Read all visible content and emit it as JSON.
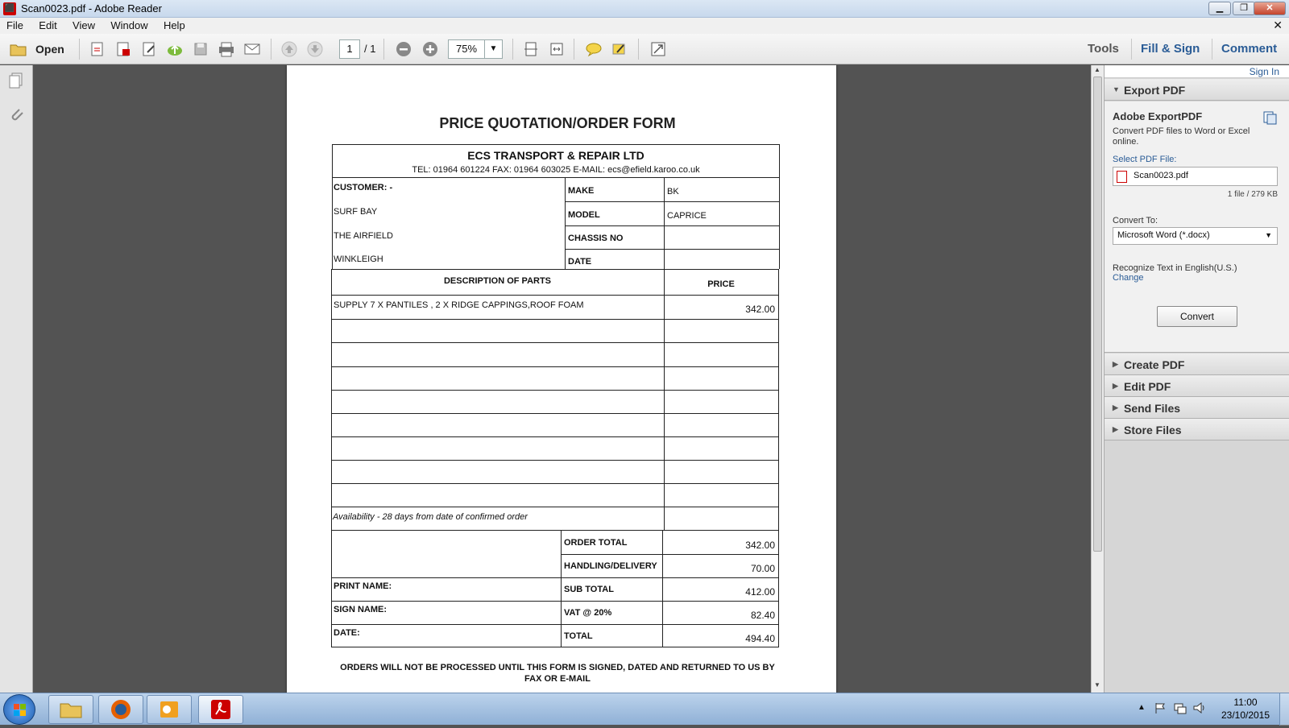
{
  "window": {
    "title": "Scan0023.pdf - Adobe Reader",
    "minimize": "▁",
    "maximize": "❐",
    "close": "✕",
    "doc_close": "✕"
  },
  "menu": [
    "File",
    "Edit",
    "View",
    "Window",
    "Help"
  ],
  "toolbar": {
    "open_label": "Open",
    "page_current": "1",
    "page_total": "/ 1",
    "zoom": "75%"
  },
  "right_tabs": {
    "tools": "Tools",
    "fill_sign": "Fill & Sign",
    "comment": "Comment"
  },
  "document": {
    "title": "PRICE QUOTATION/ORDER FORM",
    "company": "ECS TRANSPORT & REPAIR LTD",
    "contact": "TEL: 01964 601224   FAX: 01964 603025   E-MAIL: ecs@efield.karoo.co.uk",
    "customer_label": "CUSTOMER: -",
    "customer_lines": [
      "SURF BAY",
      "THE AIRFIELD",
      "WINKLEIGH"
    ],
    "vehicle": [
      {
        "label": "MAKE",
        "value": "BK"
      },
      {
        "label": "MODEL",
        "value": "CAPRICE"
      },
      {
        "label": "CHASSIS NO",
        "value": ""
      },
      {
        "label": "DATE",
        "value": ""
      }
    ],
    "desc_header": "DESCRIPTION OF PARTS",
    "price_header": "PRICE",
    "line_item": {
      "description": "SUPPLY 7 X PANTILES , 2 X RIDGE CAPPINGS,ROOF FOAM",
      "price": "342.00"
    },
    "availability": "Availability - 28 days from date of confirmed order",
    "totals": [
      {
        "label": "ORDER TOTAL",
        "value": "342.00"
      },
      {
        "label": "HANDLING/DELIVERY",
        "value": "70.00"
      },
      {
        "label": "SUB TOTAL",
        "value": "412.00"
      },
      {
        "label": "VAT @ 20%",
        "value": "82.40"
      },
      {
        "label": "TOTAL",
        "value": "494.40"
      }
    ],
    "sign_fields": [
      "PRINT NAME:",
      "SIGN NAME:",
      "DATE:"
    ],
    "footer": "ORDERS WILL NOT BE PROCESSED UNTIL THIS FORM IS SIGNED, DATED AND RETURNED TO US BY",
    "footer2": "FAX OR E-MAIL"
  },
  "panel": {
    "sign_in": "Sign In",
    "export_header": "Export PDF",
    "export_title": "Adobe ExportPDF",
    "export_desc": "Convert PDF files to Word or Excel online.",
    "select_label": "Select PDF File:",
    "file_name": "Scan0023.pdf",
    "file_info": "1 file / 279 KB",
    "convert_to_label": "Convert To:",
    "convert_to_value": "Microsoft Word (*.docx)",
    "recognize_text": "Recognize Text in English(U.S.)",
    "change_link": "Change",
    "convert_button": "Convert",
    "sections": [
      "Create PDF",
      "Edit PDF",
      "Send Files",
      "Store Files"
    ]
  },
  "taskbar": {
    "time": "11:00",
    "date": "23/10/2015"
  },
  "colors": {
    "accent_blue": "#2a5c96",
    "pdf_red": "#c00000"
  }
}
